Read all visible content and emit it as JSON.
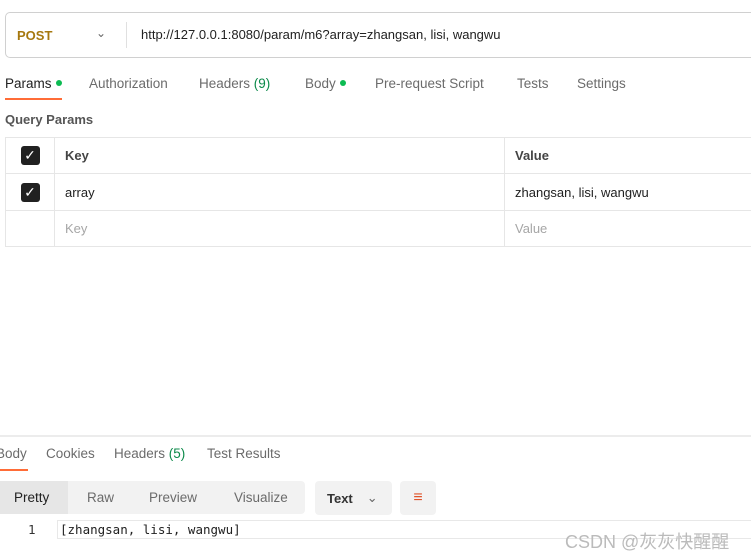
{
  "request": {
    "method": "POST",
    "url": "http://127.0.0.1:8080/param/m6?array=zhangsan, lisi, wangwu"
  },
  "tabs": [
    {
      "label": "Params",
      "dot": true
    },
    {
      "label": "Authorization"
    },
    {
      "label": "Headers",
      "count": "(9)"
    },
    {
      "label": "Body",
      "dot": true
    },
    {
      "label": "Pre-request Script"
    },
    {
      "label": "Tests"
    },
    {
      "label": "Settings"
    }
  ],
  "query_params": {
    "title": "Query Params",
    "headers": {
      "key": "Key",
      "value": "Value"
    },
    "rows": [
      {
        "key": "array",
        "value": "zhangsan, lisi, wangwu",
        "checked": true
      }
    ],
    "placeholder": {
      "key": "Key",
      "value": "Value"
    }
  },
  "response": {
    "tabs": [
      {
        "label": "Body"
      },
      {
        "label": "Cookies"
      },
      {
        "label": "Headers",
        "count": "(5)"
      },
      {
        "label": "Test Results"
      }
    ],
    "views": [
      "Pretty",
      "Raw",
      "Preview",
      "Visualize"
    ],
    "format": "Text",
    "lines": [
      {
        "n": "1",
        "text": "[zhangsan, lisi, wangwu]"
      }
    ]
  },
  "watermark": "CSDN @灰灰快醒醒",
  "colors": {
    "accent": "#ff6c37",
    "method": "#a6780f",
    "dot": "#0cbb52"
  }
}
